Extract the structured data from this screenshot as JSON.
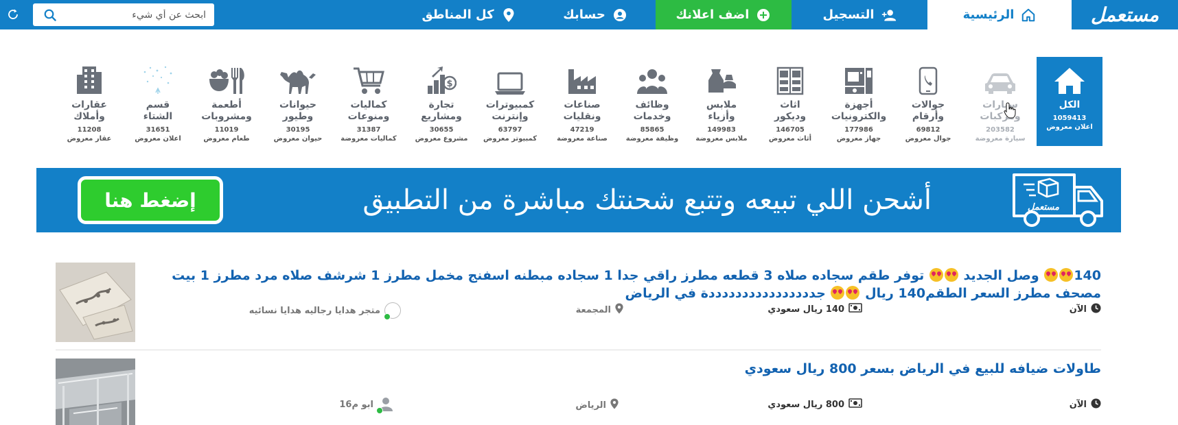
{
  "nav": {
    "logo": "مستعمل",
    "home": "الرئيسية",
    "register": "التسجيل",
    "add_ad": "اضف اعلانك",
    "account": "حسابك",
    "areas": "كل المناطق",
    "search_placeholder": "ابحث عن أي شيء"
  },
  "categories": [
    {
      "name": "الكل",
      "count": "1059413",
      "sub": "اعلان معروض",
      "icon": "home-icon"
    },
    {
      "name": "سيارات\nومركبات",
      "count": "203582",
      "sub": "سيارة معروضة",
      "icon": "car-icon"
    },
    {
      "name": "جوالات\nوأرقام",
      "count": "69812",
      "sub": "جوال معروض",
      "icon": "phone-icon"
    },
    {
      "name": "أجهزة\nوالكترونيات",
      "count": "177986",
      "sub": "جهاز معروض",
      "icon": "appliance-icon"
    },
    {
      "name": "اثاث\nوديكور",
      "count": "146705",
      "sub": "أثاث معروض",
      "icon": "furniture-icon"
    },
    {
      "name": "ملابس\nوأزياء",
      "count": "149983",
      "sub": "ملابس معروضة",
      "icon": "clothes-icon"
    },
    {
      "name": "وظائف\nوخدمات",
      "count": "85865",
      "sub": "وظيفة معروضة",
      "icon": "people-icon"
    },
    {
      "name": "صناعات\nونقليات",
      "count": "47219",
      "sub": "صناعة معروضة",
      "icon": "factory-icon"
    },
    {
      "name": "كمبيوترات\nوإنترنت",
      "count": "63797",
      "sub": "كمبيوتر معروض",
      "icon": "laptop-icon"
    },
    {
      "name": "تجارة\nومشاريع",
      "count": "30655",
      "sub": "مشروع معروض",
      "icon": "business-icon"
    },
    {
      "name": "كماليات\nومنوعات",
      "count": "31387",
      "sub": "كماليات معروضة",
      "icon": "cart-icon"
    },
    {
      "name": "حيوانات\nوطيور",
      "count": "30195",
      "sub": "حيوان معروض",
      "icon": "camel-icon"
    },
    {
      "name": "أطعمة\nومشروبات",
      "count": "11019",
      "sub": "طعام معروض",
      "icon": "food-icon"
    },
    {
      "name": "قسم\nالشتاء",
      "count": "31651",
      "sub": "اعلان معروض",
      "icon": "snow-icon"
    },
    {
      "name": "عقارات\nوأملاك",
      "count": "11208",
      "sub": "عقار معروض",
      "icon": "building-icon"
    }
  ],
  "banner": {
    "text": "أشحن اللي تبيعه وتتبع شحنتك مباشرة من التطبيق",
    "button": "إضغط هنا",
    "truck_label": "مستعمل"
  },
  "listings": [
    {
      "title_a": "140",
      "title_b": " وصل الجديد ",
      "title_c": " توفر طقم سجاده صلاه 3 قطعه مطرز راقي جدا 1 سجاده مبطنه اسفنج مخمل مطرز 1 شرشف صلاه مرد مطرز 1 بيت مصحف مطرز السعر الطقم140 ريال ",
      "title_d": " جددددددددددددددددة في الرياض",
      "time": "الآن",
      "price": "140 ريال سعودي",
      "location": "المجمعة",
      "seller": "متجر هدايا رجاليه هدايا نسائيه"
    },
    {
      "title": "طاولات ضيافه للبيع في الرياض بسعر 800 ريال سعودي",
      "time": "الآن",
      "price": "800 ريال سعودي",
      "location": "الرياض",
      "seller": "ابو م16"
    }
  ]
}
